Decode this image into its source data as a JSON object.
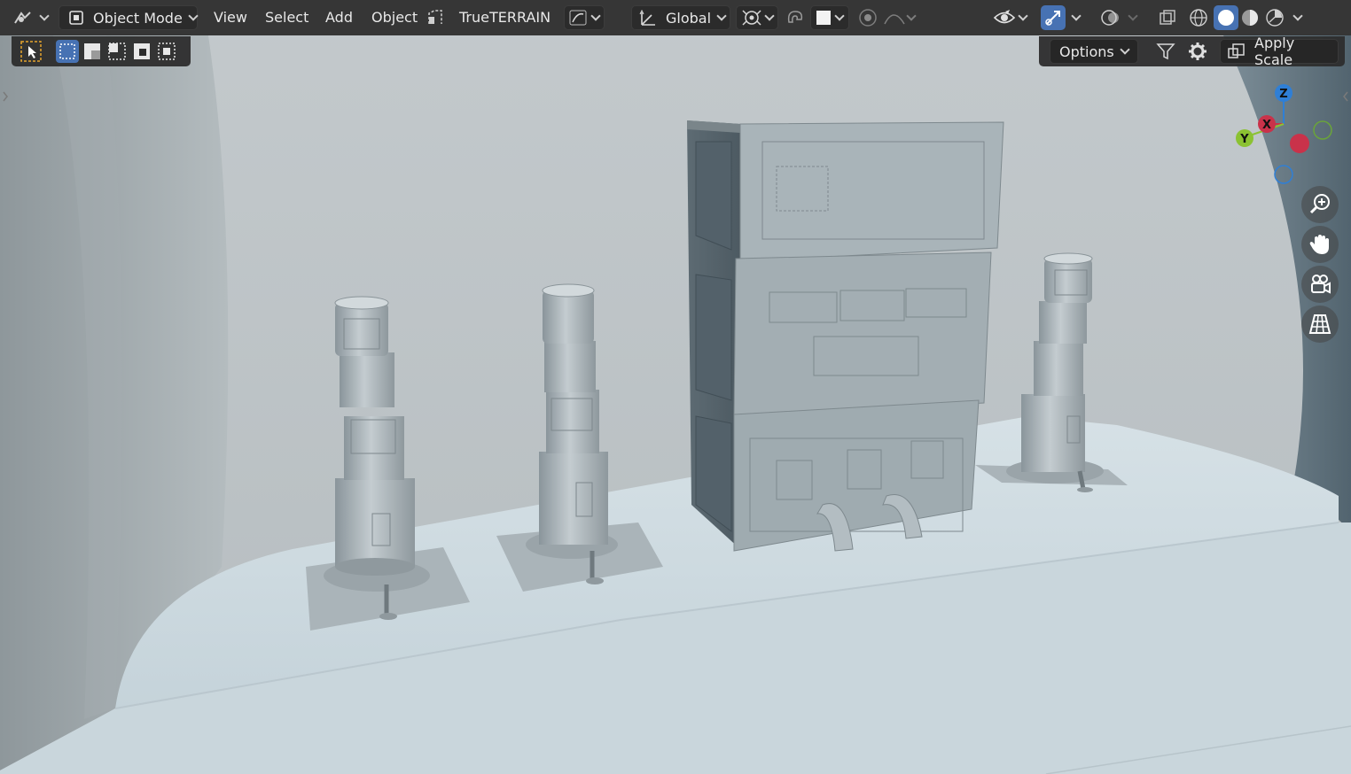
{
  "header": {
    "mode_label": "Object Mode",
    "menus": [
      "View",
      "Select",
      "Add",
      "Object"
    ],
    "addon_label": "TrueTERRAIN",
    "transform_orientation": "Global"
  },
  "right_toolbar": {
    "options_label": "Options",
    "apply_scale_label": "Apply Scale"
  },
  "gizmo": {
    "x_label": "X",
    "y_label": "Y",
    "z_label": "Z",
    "colors": {
      "x": "#c9324a",
      "y": "#8bc232",
      "z": "#2f7fd6"
    }
  },
  "icons": {
    "editor_type": "editor-type-icon",
    "mode": "object-mode-icon",
    "addon": "true-terrain-icon",
    "curve": "curve-icon",
    "orientation": "transform-orientation-icon",
    "pivot": "pivot-point-icon",
    "snap": "snap-magnet-icon",
    "proportional": "proportional-edit-icon",
    "visibility": "visibility-eye-icon",
    "gizmo_toggle": "gizmo-toggle-icon",
    "overlay": "overlay-icon",
    "xray": "xray-icon",
    "shading_wire": "wireframe-shading-icon",
    "shading_solid": "solid-shading-icon",
    "shading_material": "material-shading-icon",
    "shading_rendered": "rendered-shading-icon",
    "filter": "filter-icon",
    "settings": "gear-icon",
    "zoom": "zoom-icon",
    "pan": "hand-icon",
    "camera": "camera-icon",
    "grid": "perspective-grid-icon"
  },
  "colors": {
    "accent": "#4772b3",
    "header_bg": "#303030",
    "viewport_wall": "#b9c2c6",
    "viewport_floor": "#cfdce2"
  }
}
